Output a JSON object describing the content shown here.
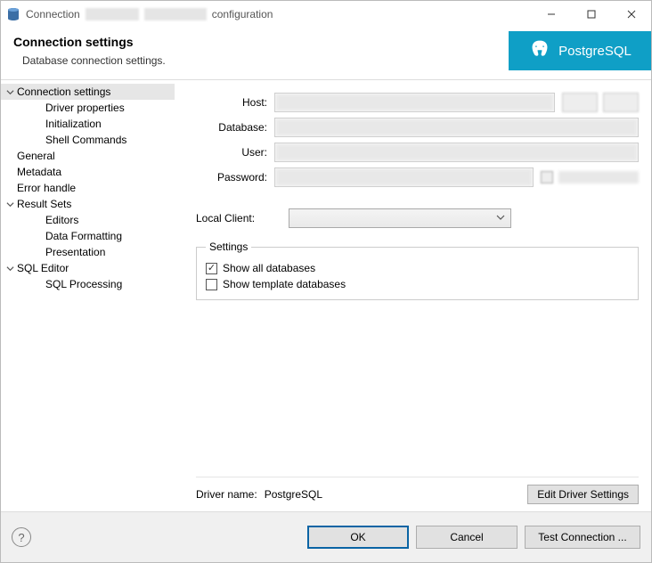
{
  "window": {
    "title_prefix": "Connection",
    "title_suffix": "configuration"
  },
  "header": {
    "title": "Connection settings",
    "subtitle": "Database connection settings.",
    "brand": "PostgreSQL"
  },
  "nav": {
    "items": [
      {
        "label": "Connection settings",
        "level": 0,
        "expandable": true,
        "expanded": true,
        "selected": true
      },
      {
        "label": "Driver properties",
        "level": 1
      },
      {
        "label": "Initialization",
        "level": 1
      },
      {
        "label": "Shell Commands",
        "level": 1
      },
      {
        "label": "General",
        "level": 0
      },
      {
        "label": "Metadata",
        "level": 0
      },
      {
        "label": "Error handle",
        "level": 0
      },
      {
        "label": "Result Sets",
        "level": 0,
        "expandable": true,
        "expanded": true
      },
      {
        "label": "Editors",
        "level": 1
      },
      {
        "label": "Data Formatting",
        "level": 1
      },
      {
        "label": "Presentation",
        "level": 1
      },
      {
        "label": "SQL Editor",
        "level": 0,
        "expandable": true,
        "expanded": true
      },
      {
        "label": "SQL Processing",
        "level": 1
      }
    ]
  },
  "form": {
    "labels": {
      "host": "Host:",
      "database": "Database:",
      "user": "User:",
      "password": "Password:",
      "local_client": "Local Client:"
    },
    "local_client_value": ""
  },
  "settings_group": {
    "legend": "Settings",
    "show_all_databases": {
      "label": "Show all databases",
      "checked": true
    },
    "show_template_databases": {
      "label": "Show template databases",
      "checked": false
    }
  },
  "driver": {
    "label": "Driver name:",
    "value": "PostgreSQL",
    "edit_button": "Edit Driver Settings"
  },
  "footer": {
    "ok": "OK",
    "cancel": "Cancel",
    "test": "Test Connection ..."
  }
}
